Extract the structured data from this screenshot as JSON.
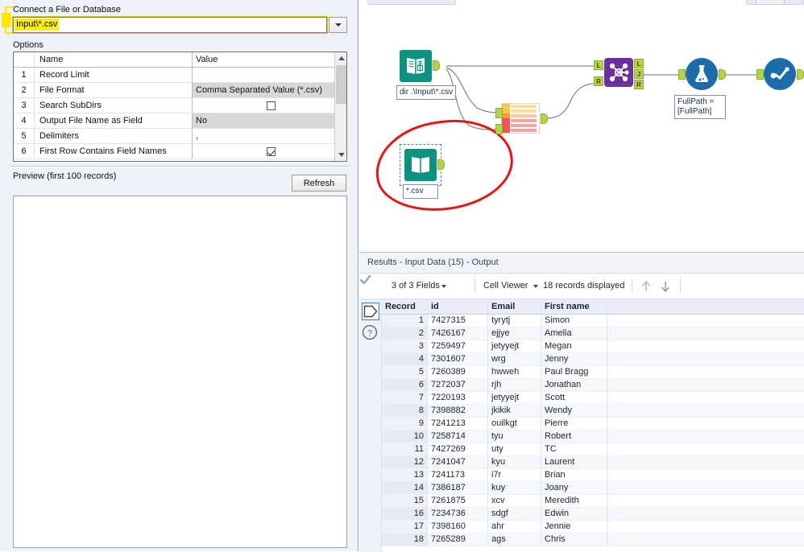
{
  "config_panel": {
    "connect_label": "Connect a File or Database",
    "file_path": "Input\\*.csv",
    "dropdown_icon": "chevron-down-icon",
    "options_label": "Options",
    "columns": [
      "Name",
      "Value"
    ],
    "rows": [
      {
        "num": "1",
        "name": "Record Limit",
        "value": "",
        "type": "text"
      },
      {
        "num": "2",
        "name": "File Format",
        "value": "Comma Separated Value (*.csv)",
        "type": "combo"
      },
      {
        "num": "3",
        "name": "Search SubDirs",
        "value": "",
        "type": "checkbox",
        "checked": false
      },
      {
        "num": "4",
        "name": "Output File Name as Field",
        "value": "No",
        "type": "combo"
      },
      {
        "num": "5",
        "name": "Delimiters",
        "value": ",",
        "type": "text"
      },
      {
        "num": "6",
        "name": "First Row Contains Field Names",
        "value": "",
        "type": "checkbox",
        "checked": true
      }
    ],
    "preview_label": "Preview (first 100 records)",
    "refresh_label": "Refresh"
  },
  "canvas": {
    "nodes": [
      {
        "id": "directory",
        "icon": "directory-book-icon",
        "label": "dir .\\Input\\*.csv",
        "color": "#0e9280"
      },
      {
        "id": "input-data-selected",
        "icon": "input-data-book-icon",
        "label": "*.csv",
        "color": "#0e9280",
        "selected": true
      },
      {
        "id": "compare-rows",
        "icon": "field-rows-icon",
        "label": "",
        "color": "#f2994a"
      },
      {
        "id": "join",
        "icon": "join-icon",
        "label": "",
        "color": "#6b2f9e",
        "in_ports": [
          "L",
          "R"
        ],
        "out_ports": [
          "L",
          "J",
          "R"
        ]
      },
      {
        "id": "formula",
        "icon": "formula-flask-icon",
        "label": "FullPath =\n[FullPath]",
        "color": "#1b6ca8"
      },
      {
        "id": "browse",
        "icon": "browse-chart-icon",
        "label": "",
        "color": "#1b6ca8"
      }
    ],
    "annotation": "red-circle-highlight"
  },
  "results": {
    "title": "Results - Input Data (15) - Output",
    "toolbar": {
      "fields_count": "3 of 3 Fields",
      "fields_caret": "chevron-down-icon",
      "check_icon": "check-icon",
      "cell_viewer": "Cell Viewer",
      "cell_viewer_caret": "chevron-down-icon",
      "records_displayed": "18 records displayed",
      "sort_up_icon": "arrow-up-icon",
      "sort_down_icon": "arrow-down-icon"
    },
    "rail": {
      "data_icon": "data-stack-icon",
      "metadata_icon": "metadata-tag-icon",
      "help_icon": "help-question-icon"
    },
    "columns": [
      "Record",
      "id",
      "Email",
      "First name"
    ],
    "rows": [
      {
        "record": "1",
        "id": "7427315",
        "email": "tyrytj",
        "first_name": "Simon"
      },
      {
        "record": "2",
        "id": "7426167",
        "email": "ejjye",
        "first_name": "Amelia"
      },
      {
        "record": "3",
        "id": "7259497",
        "email": "jetyyejt",
        "first_name": "Megan"
      },
      {
        "record": "4",
        "id": "7301607",
        "email": "wrg",
        "first_name": "Jenny"
      },
      {
        "record": "5",
        "id": "7260389",
        "email": "hwweh",
        "first_name": "Paul Bragg"
      },
      {
        "record": "6",
        "id": "7272037",
        "email": "rjh",
        "first_name": "Jonathan"
      },
      {
        "record": "7",
        "id": "7220193",
        "email": "jetyyejt",
        "first_name": "Scott"
      },
      {
        "record": "8",
        "id": "7398882",
        "email": "jkikik",
        "first_name": "Wendy"
      },
      {
        "record": "9",
        "id": "7241213",
        "email": "ouilkgt",
        "first_name": "Pierre"
      },
      {
        "record": "10",
        "id": "7258714",
        "email": "tyu",
        "first_name": "Robert"
      },
      {
        "record": "11",
        "id": "7427269",
        "email": "uty",
        "first_name": "TC"
      },
      {
        "record": "12",
        "id": "7241047",
        "email": "kyu",
        "first_name": "Laurent"
      },
      {
        "record": "13",
        "id": "7241173",
        "email": "i7r",
        "first_name": "Brian"
      },
      {
        "record": "14",
        "id": "7386187",
        "email": "kuy",
        "first_name": "Joany"
      },
      {
        "record": "15",
        "id": "7261875",
        "email": "xcv",
        "first_name": "Meredith"
      },
      {
        "record": "16",
        "id": "7234736",
        "email": "sdgf",
        "first_name": "Edwin"
      },
      {
        "record": "17",
        "id": "7398160",
        "email": "ahr",
        "first_name": "Jennie"
      },
      {
        "record": "18",
        "id": "7265289",
        "email": "ags",
        "first_name": "Chris"
      }
    ]
  },
  "colors": {
    "teal": "#0e9280",
    "purple": "#6b2f9e",
    "blue": "#1b6ca8",
    "port_green": "#b5d34a",
    "highlight_yellow": "#ffef00",
    "annotation_red": "#ee1111"
  }
}
